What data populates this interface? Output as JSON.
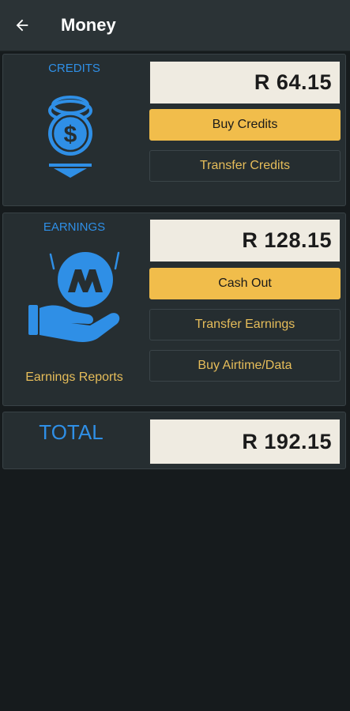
{
  "appbar": {
    "title": "Money",
    "back_icon": "arrow-left-icon"
  },
  "credits": {
    "label": "CREDITS",
    "amount": "R 64.15",
    "icon": "coin-dollar-icon",
    "buy_button": "Buy Credits",
    "transfer_button": "Transfer Credits"
  },
  "earnings": {
    "label": "EARNINGS",
    "amount": "R 128.15",
    "icon": "hand-coin-icon",
    "cashout_button": "Cash Out",
    "transfer_button": "Transfer Earnings",
    "airtime_button": "Buy Airtime/Data",
    "reports_link": "Earnings Reports"
  },
  "total": {
    "label": "TOTAL",
    "amount": "R 192.15"
  },
  "colors": {
    "accent_blue": "#2f8fe6",
    "button_yellow": "#f1bd4b",
    "text_gold": "#e6bd5a",
    "background": "#161b1d",
    "card": "#262e31"
  }
}
